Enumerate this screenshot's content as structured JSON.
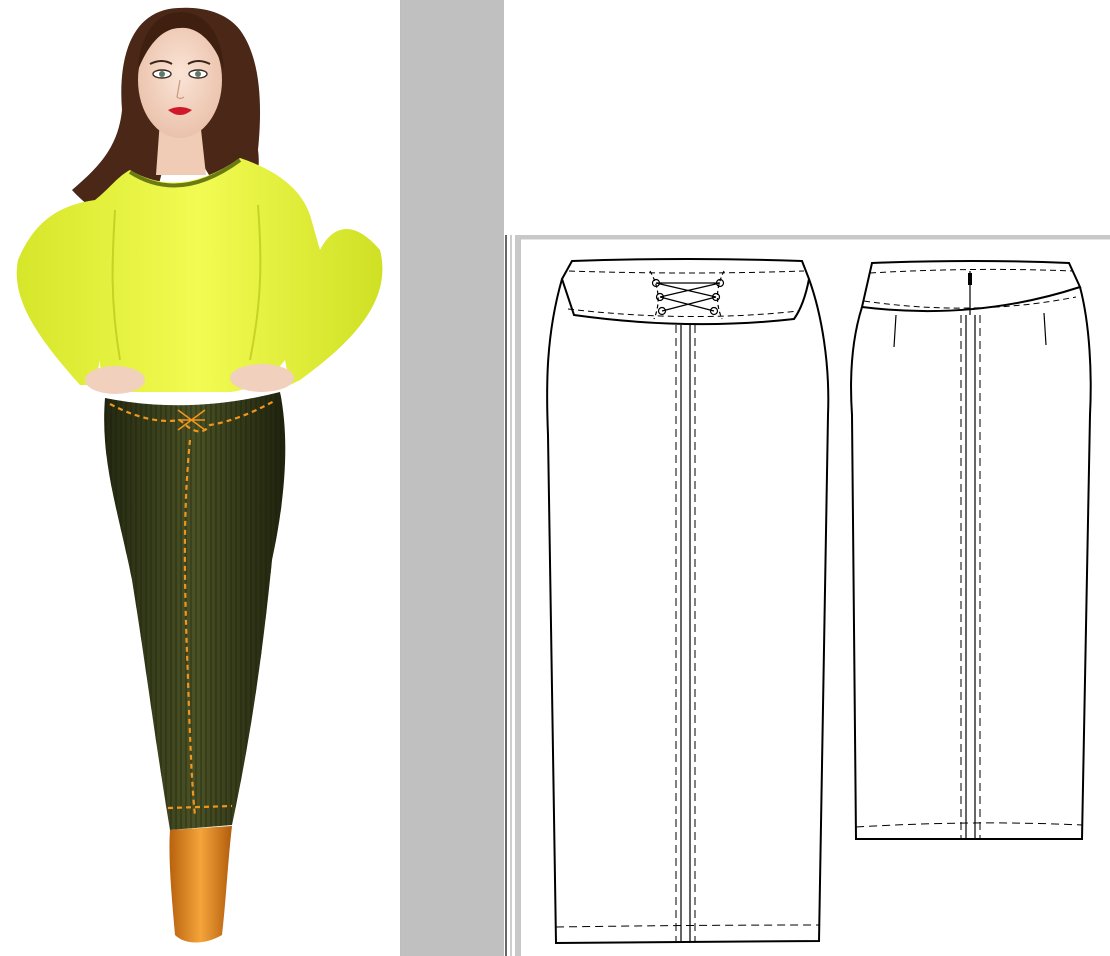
{
  "top_strip": {
    "clipped_text": "• • • • • • • • • • • • • • • • • • • • • • •"
  },
  "colors": {
    "top": "#e8f53a",
    "skirt": "#2f3416",
    "stitching": "#f0961e",
    "boots": "#e08a1e",
    "hair": "#4a2716",
    "skin": "#f3d3c0",
    "gray_strip": "#c0c0c0",
    "line": "#000000"
  },
  "figure": {
    "label": "fashion-figure"
  },
  "sketches": [
    {
      "name": "front-view",
      "features": [
        "waistband",
        "lace-up-detail",
        "center-seam",
        "hem-stitch"
      ]
    },
    {
      "name": "back-view",
      "features": [
        "waistband",
        "darts",
        "zipper",
        "center-seam",
        "hem-stitch"
      ]
    }
  ]
}
